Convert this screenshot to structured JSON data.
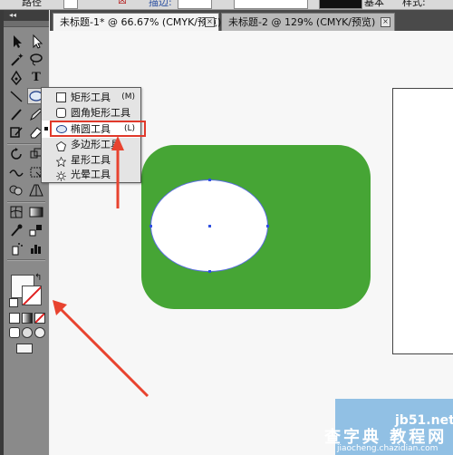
{
  "control_bar": {
    "path_label": "路径",
    "stroke_label": "描边:",
    "basic_label": "基本",
    "style_label": "样式:"
  },
  "tabs": [
    {
      "label": "未标题-1* @ 66.67% (CMYK/预览)",
      "close": "×"
    },
    {
      "label": "未标题-2 @ 129% (CMYK/预览)",
      "close": "×"
    }
  ],
  "toolbar": {
    "collapse_glyph": "◂◂",
    "tools": [
      "selection",
      "direct-selection",
      "magic-wand",
      "lasso",
      "pen",
      "type",
      "line",
      "ellipse",
      "paintbrush",
      "pencil",
      "blob-brush",
      "eraser",
      "rotate",
      "scale",
      "warp",
      "free-transform",
      "shape-builder",
      "perspective",
      "mesh",
      "gradient",
      "eyedropper",
      "blend",
      "symbol-sprayer",
      "column-graph",
      "artboard",
      "slice",
      "hand",
      "zoom"
    ]
  },
  "flyout_menu": {
    "items": [
      {
        "label": "矩形工具",
        "shortcut": "(M)",
        "icon": "rectangle-icon"
      },
      {
        "label": "圆角矩形工具",
        "shortcut": "",
        "icon": "rounded-rectangle-icon"
      },
      {
        "label": "椭圆工具",
        "shortcut": "(L)",
        "icon": "ellipse-icon",
        "selected": true
      },
      {
        "label": "多边形工具",
        "shortcut": "",
        "icon": "polygon-icon"
      },
      {
        "label": "星形工具",
        "shortcut": "",
        "icon": "star-icon"
      },
      {
        "label": "光晕工具",
        "shortcut": "",
        "icon": "flare-icon"
      }
    ]
  },
  "canvas": {
    "shape_color": "#46a535",
    "ellipse_fill": "#ffffff",
    "highlight_color": "#e0392b",
    "arrow_color": "#e8432f"
  },
  "watermark": {
    "domain": "jb51.net",
    "brand": "查字典 教程网",
    "url": "jiaocheng.chazidian.com"
  }
}
